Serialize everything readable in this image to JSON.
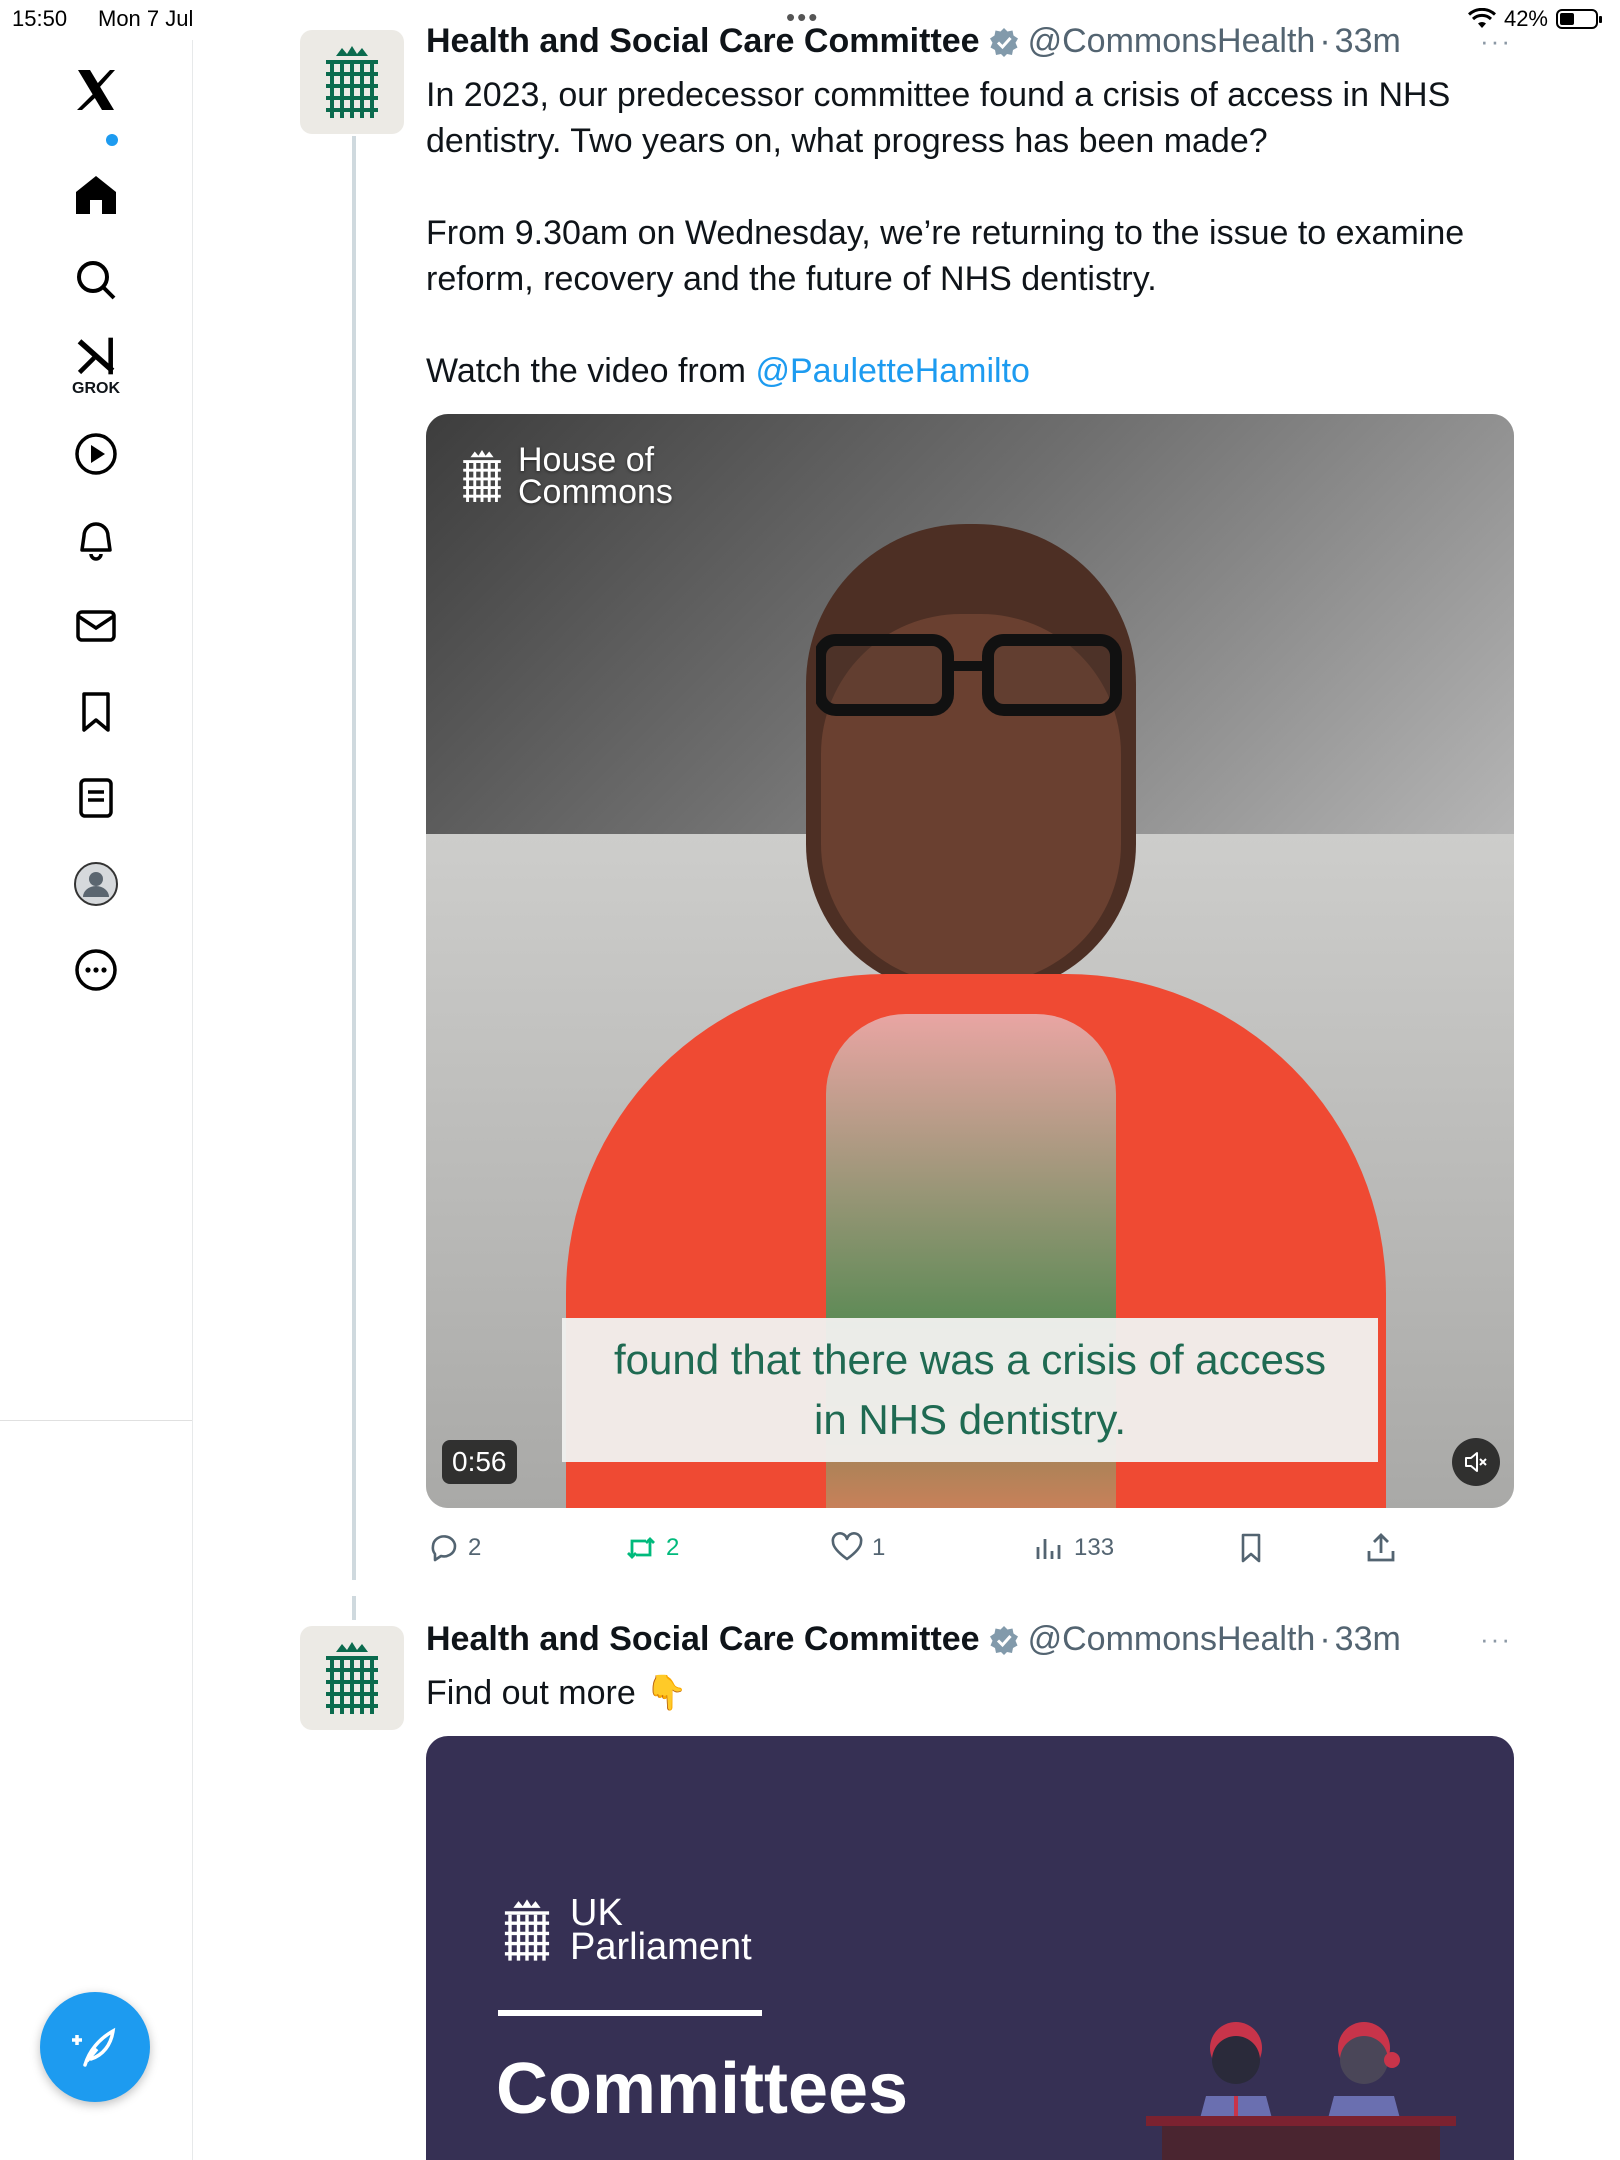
{
  "status_bar": {
    "time": "15:50",
    "date": "Mon 7 Jul",
    "battery": "42%"
  },
  "sidebar": {
    "items": [
      {
        "name": "x-logo-icon"
      },
      {
        "name": "home-icon",
        "has_badge": true
      },
      {
        "name": "search-icon"
      },
      {
        "name": "grok-icon",
        "label": "GROK"
      },
      {
        "name": "video-icon"
      },
      {
        "name": "notifications-icon"
      },
      {
        "name": "messages-icon"
      },
      {
        "name": "bookmarks-icon"
      },
      {
        "name": "lists-icon"
      },
      {
        "name": "profile-icon"
      },
      {
        "name": "more-icon"
      }
    ],
    "compose_icon": "compose-icon"
  },
  "tweets": [
    {
      "author": "Health and Social Care Committee",
      "handle": "@CommonsHealth",
      "separator": "·",
      "time": "33m",
      "more": "···",
      "text_1": "In 2023, our predecessor committee found a crisis of access in NHS dentistry. Two years on, what progress has been made?",
      "text_2": "From 9.30am on Wednesday, we’re returning to the issue to examine reform, recovery and the future of NHS dentistry.",
      "text_3_prefix": "Watch the video from ",
      "text_3_mention": "@PauletteHamilto",
      "video": {
        "watermark_line1": "House of",
        "watermark_line2": "Commons",
        "caption_line1": "found that there was a crisis of access",
        "caption_line2": "in NHS dentistry.",
        "duration": "0:56"
      },
      "stats": {
        "replies": "2",
        "reposts": "2",
        "likes": "1",
        "views": "133"
      }
    },
    {
      "author": "Health and Social Care Committee",
      "handle": "@CommonsHealth",
      "separator": "·",
      "time": "33m",
      "more": "···",
      "text": "Find out more 👇",
      "card": {
        "brand_line1": "UK",
        "brand_line2": "Parliament",
        "title": "Committees"
      }
    }
  ],
  "colors": {
    "accent": "#1d9bf0",
    "repost": "#00ba7c",
    "card_bg": "#363054",
    "caption_text": "#1f6a52"
  }
}
